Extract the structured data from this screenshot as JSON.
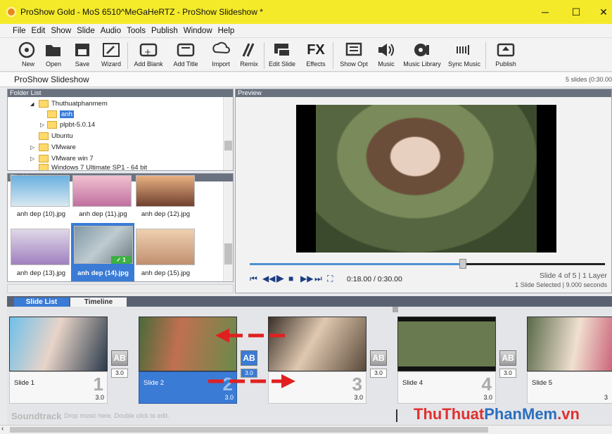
{
  "window": {
    "title": "ProShow Gold - MoS 6510^MeGaHeRTZ - ProShow Slideshow *",
    "minimize": "─",
    "maximize": "☐",
    "close": "✕"
  },
  "menu": [
    "File",
    "Edit",
    "Show",
    "Slide",
    "Audio",
    "Tools",
    "Publish",
    "Window",
    "Help"
  ],
  "toolbar": [
    {
      "label": "New",
      "icon": "new-icon"
    },
    {
      "label": "Open",
      "icon": "open-folder-icon"
    },
    {
      "label": "Save",
      "icon": "save-icon"
    },
    {
      "label": "Wizard",
      "icon": "wizard-icon"
    },
    {
      "label": "Add Blank",
      "icon": "add-blank-icon"
    },
    {
      "label": "Add Title",
      "icon": "add-title-icon"
    },
    {
      "label": "Import",
      "icon": "import-icon"
    },
    {
      "label": "Remix",
      "icon": "remix-icon"
    },
    {
      "label": "Edit Slide",
      "icon": "edit-slide-icon"
    },
    {
      "label": "Effects",
      "icon": "effects-icon"
    },
    {
      "label": "Show Opt",
      "icon": "show-options-icon"
    },
    {
      "label": "Music",
      "icon": "music-icon"
    },
    {
      "label": "Music Library",
      "icon": "music-library-icon"
    },
    {
      "label": "Sync Music",
      "icon": "sync-music-icon"
    },
    {
      "label": "Publish",
      "icon": "publish-icon"
    }
  ],
  "effects_glyph": "FX",
  "show": {
    "title": "ProShow Slideshow",
    "info": "5 slides (0:30.00"
  },
  "folder_list": {
    "header": "Folder List",
    "items": [
      {
        "label": "Thuthuatphanmem",
        "expander": "◢"
      },
      {
        "label": "anh",
        "expander": ""
      },
      {
        "label": "plpbt-5.0.14",
        "expander": "▷"
      },
      {
        "label": "Ubuntu",
        "expander": ""
      },
      {
        "label": "VMware",
        "expander": "▷"
      },
      {
        "label": "VMware win 7",
        "expander": "▷"
      },
      {
        "label": "Windows 7 Ultimate SP1 - 64 bit",
        "expander": ""
      }
    ]
  },
  "file_list": {
    "header": "File List",
    "files": [
      "anh dep (10).jpg",
      "anh dep (11).jpg",
      "anh dep (12).jpg",
      "anh dep (13).jpg",
      "anh dep (14).jpg",
      "anh dep (15).jpg"
    ],
    "selected_badge": "✓ 1"
  },
  "preview": {
    "header": "Preview",
    "time": "0:18.00 / 0:30.00",
    "progress": 0.6,
    "slide_info": "Slide 4 of 5  |  1 Layer",
    "selection_info": "1 Slide Selected  |  9.000 seconds",
    "controls": [
      "⏮",
      "◀◀",
      "▶",
      "■",
      "▶▶",
      "⏭",
      "⛶"
    ]
  },
  "tabs": [
    "Slide List",
    "Timeline"
  ],
  "slides": [
    {
      "label": "Slide 1",
      "num": "1",
      "duration": "3.0",
      "transition": "3.0"
    },
    {
      "label": "Slide 2",
      "num": "2",
      "duration": "3.0",
      "transition": "3.0"
    },
    {
      "label": "",
      "num": "3",
      "duration": "3.0",
      "transition": "3.0"
    },
    {
      "label": "Slide 4",
      "num": "4",
      "duration": "3.0",
      "transition": "3.0"
    },
    {
      "label": "Slide 5",
      "num": "",
      "duration": "3",
      "transition": ""
    }
  ],
  "transition_glyph": "AB",
  "soundtrack": {
    "title": "Soundtrack",
    "hint": "Drop music here.  Double click to edit."
  },
  "watermark": {
    "part1": "ThuThuat",
    "part2": "PhanMem",
    "part3": ".vn"
  },
  "colors": {
    "titlebar": "#f4ea2a",
    "selection": "#3a7bd5",
    "arrow": "#e02020"
  }
}
